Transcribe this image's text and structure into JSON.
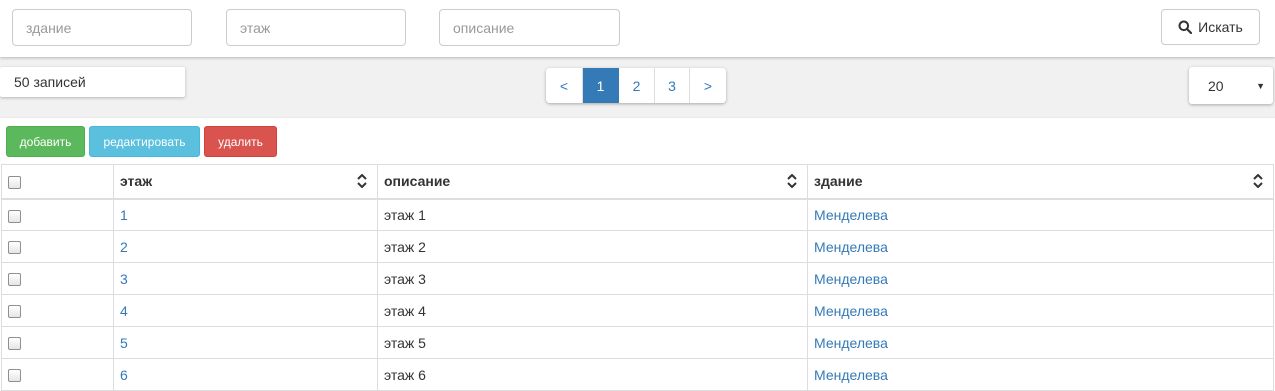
{
  "filters": {
    "building_placeholder": "здание",
    "floor_placeholder": "этаж",
    "description_placeholder": "описание",
    "search_label": "Искать"
  },
  "records_count": "50 записей",
  "pagination": {
    "prev": "<",
    "pages": [
      "1",
      "2",
      "3"
    ],
    "active": "1",
    "next": ">"
  },
  "page_size": "20",
  "actions": {
    "add": "добавить",
    "edit": "редактировать",
    "delete": "удалить"
  },
  "table": {
    "columns": [
      "этаж",
      "описание",
      "здание"
    ],
    "rows": [
      {
        "floor": "1",
        "description": "этаж 1",
        "building": "Менделева"
      },
      {
        "floor": "2",
        "description": "этаж 2",
        "building": "Менделева"
      },
      {
        "floor": "3",
        "description": "этаж 3",
        "building": "Менделева"
      },
      {
        "floor": "4",
        "description": "этаж 4",
        "building": "Менделева"
      },
      {
        "floor": "5",
        "description": "этаж 5",
        "building": "Менделева"
      },
      {
        "floor": "6",
        "description": "этаж 6",
        "building": "Менделева"
      }
    ]
  },
  "colors": {
    "primary": "#337ab7",
    "success": "#5cb85c",
    "info": "#5bc0de",
    "danger": "#d9534f"
  }
}
